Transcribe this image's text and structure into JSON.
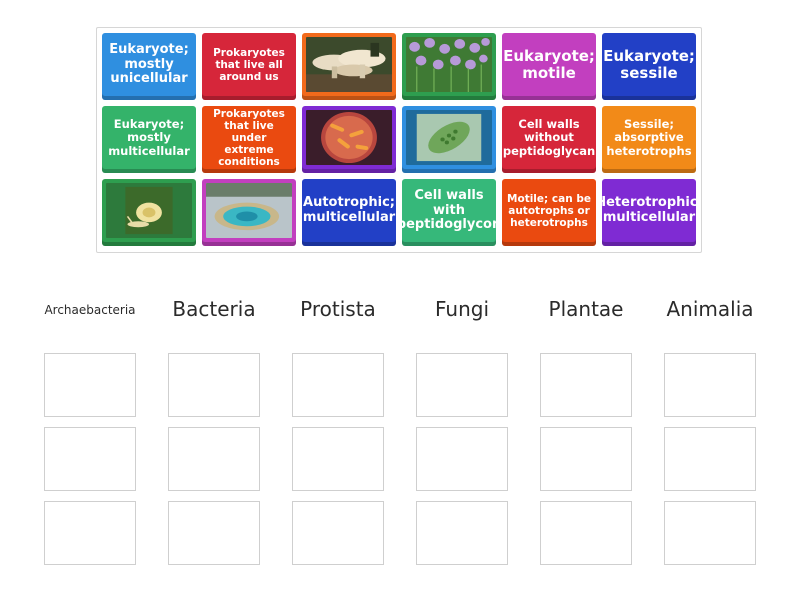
{
  "tiles": [
    {
      "id": "t1",
      "text": "Eukaryote; mostly unicellular",
      "color": "#2f8fe0",
      "image": null
    },
    {
      "id": "t2",
      "text": "Prokaryotes that live all around us",
      "color": "#d6263a",
      "image": null
    },
    {
      "id": "t3",
      "text": "",
      "color": "#f26a1b",
      "image": "mushroom"
    },
    {
      "id": "t4",
      "text": "",
      "color": "#2e9e4f",
      "image": "chives"
    },
    {
      "id": "t5",
      "text": "Eukaryote; motile",
      "color": "#c23fbf",
      "image": null
    },
    {
      "id": "t6",
      "text": "Eukaryote; sessile",
      "color": "#2240c6",
      "image": null
    },
    {
      "id": "t7",
      "text": "Eukaryote; mostly multicellular",
      "color": "#34b36a",
      "image": null
    },
    {
      "id": "t8",
      "text": "Prokaryotes that live under extreme conditions",
      "color": "#ea4a10",
      "image": null
    },
    {
      "id": "t9",
      "text": "",
      "color": "#7f2bd3",
      "image": "gut-bacteria"
    },
    {
      "id": "t10",
      "text": "",
      "color": "#2f8fe0",
      "image": "euglena"
    },
    {
      "id": "t11",
      "text": "Cell walls without peptidoglycan",
      "color": "#d6263a",
      "image": null
    },
    {
      "id": "t12",
      "text": "Sessile; absorptive heterotrophs",
      "color": "#f28a18",
      "image": null
    },
    {
      "id": "t13",
      "text": "",
      "color": "#2e9e4f",
      "image": "snail"
    },
    {
      "id": "t14",
      "text": "",
      "color": "#c23fbf",
      "image": "hot-spring"
    },
    {
      "id": "t15",
      "text": "Autotrophic; multicellular",
      "color": "#2240c6",
      "image": null
    },
    {
      "id": "t16",
      "text": "Cell walls with peptidoglycon",
      "color": "#36b87a",
      "image": null
    },
    {
      "id": "t17",
      "text": "Motile; can be autotrophs or heterotrophs",
      "color": "#ea4a10",
      "image": null
    },
    {
      "id": "t18",
      "text": "Heterotrophic; multicellular",
      "color": "#7f2bd3",
      "image": null
    }
  ],
  "columns": [
    "Archaebacteria",
    "Bacteria",
    "Protista",
    "Fungi",
    "Plantae",
    "Animalia"
  ]
}
